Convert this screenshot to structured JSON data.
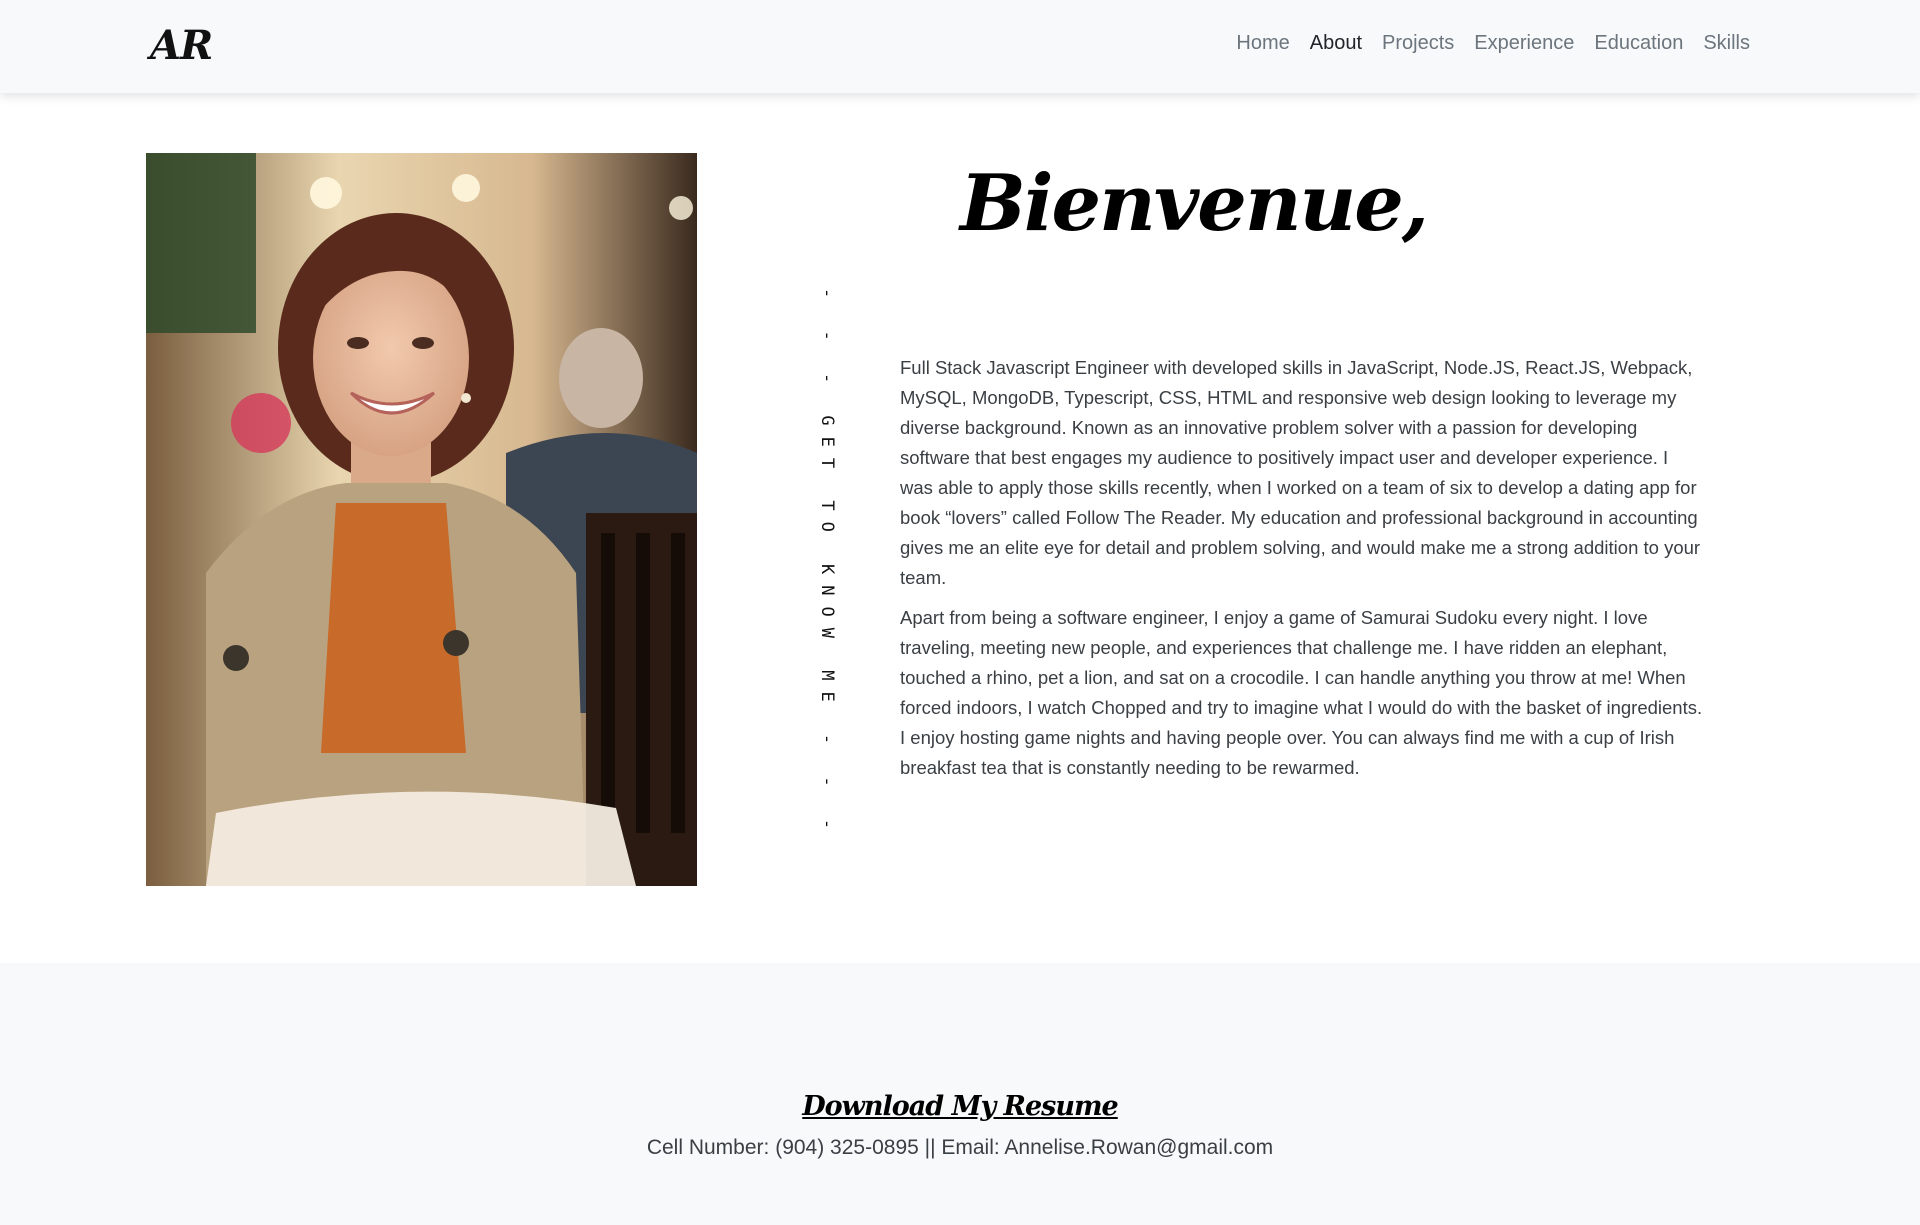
{
  "nav": {
    "brand": "AR",
    "links": [
      {
        "label": "Home",
        "active": false
      },
      {
        "label": "About",
        "active": true
      },
      {
        "label": "Projects",
        "active": false
      },
      {
        "label": "Experience",
        "active": false
      },
      {
        "label": "Education",
        "active": false
      },
      {
        "label": "Skills",
        "active": false
      }
    ]
  },
  "about": {
    "vertical_text": "- - - GET TO KNOW ME - - -",
    "welcome": "Bienvenue,",
    "paragraphs": [
      "Full Stack Javascript Engineer with developed skills in JavaScript, Node.JS, React.JS, Webpack, MySQL, MongoDB, Typescript, CSS, HTML and responsive web design looking to leverage my diverse background. Known as an innovative problem solver with a passion for developing software that best engages my audience to positively impact user and developer experience. I was able to apply those skills recently, when I worked on a team of six to develop a dating app for book “lovers” called Follow The Reader. My education and professional background in accounting gives me an elite eye for detail and problem solving, and would make me a strong addition to your team.",
      "Apart from being a software engineer, I enjoy a game of Samurai Sudoku every night. I love traveling, meeting new people, and experiences that challenge me. I have ridden an elephant, touched a rhino, pet a lion, and sat on a crocodile. I can handle anything you throw at me! When forced indoors, I watch Chopped and try to imagine what I would do with the basket of ingredients. I enjoy hosting game nights and having people over. You can always find me with a cup of Irish breakfast tea that is constantly needing to be rewarmed."
    ]
  },
  "footer": {
    "resume_label": "Download My Resume",
    "contact": "Cell Number: (904) 325-0895 || Email: Annelise.Rowan@gmail.com"
  },
  "colors": {
    "navbar_bg": "#f8f9fa",
    "nav_link": "#6c757d",
    "nav_link_active": "#212529",
    "body_text": "#3a3f44"
  }
}
